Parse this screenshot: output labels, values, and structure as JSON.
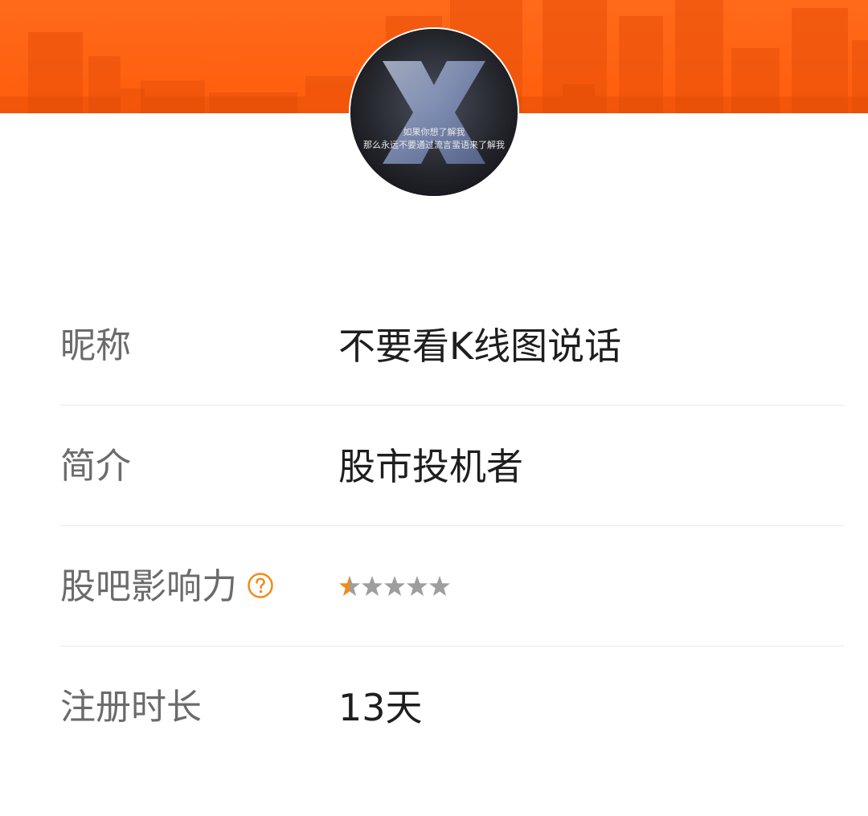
{
  "header": {
    "banner_color": "#ff6a1a",
    "avatar": {
      "caption_line1": "如果你想了解我",
      "caption_line2": "那么永远不要通过流言蜚语来了解我"
    }
  },
  "profile": {
    "rows": [
      {
        "label": "昵称",
        "value": "不要看K线图说话"
      },
      {
        "label": "简介",
        "value": "股市投机者"
      },
      {
        "label": "股吧影响力",
        "icon": "help-circle-icon",
        "rating": {
          "value": 0.5,
          "max": 5,
          "active_color": "#f08c1a",
          "inactive_color": "#9e9e9e"
        }
      },
      {
        "label": "注册时长",
        "value": "13天"
      }
    ]
  }
}
